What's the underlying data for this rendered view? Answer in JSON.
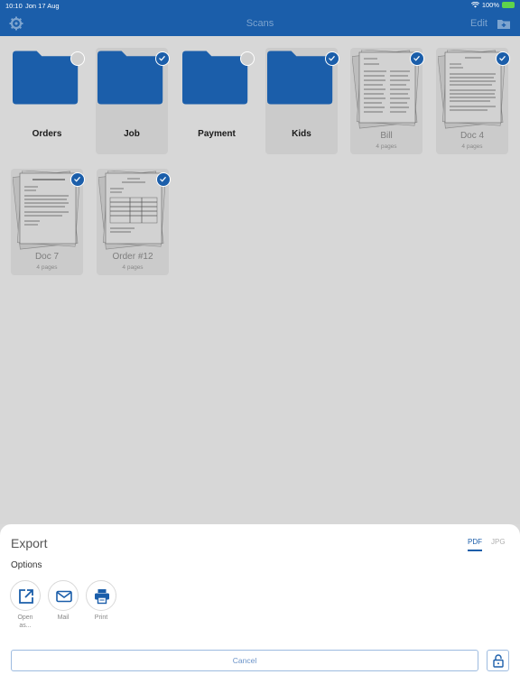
{
  "status_bar": {
    "time": "10:10",
    "date": "Jon 17 Aug",
    "battery": "100%"
  },
  "nav": {
    "title": "Scans",
    "edit_label": "Edit"
  },
  "items": [
    {
      "label": "Orders",
      "type": "folder",
      "checked": false
    },
    {
      "label": "Job",
      "type": "folder",
      "checked": true
    },
    {
      "label": "Payment",
      "type": "folder",
      "checked": false
    },
    {
      "label": "Kids",
      "type": "folder",
      "checked": true
    },
    {
      "label": "Bill",
      "type": "doc",
      "pages": "4 pages",
      "checked": true
    },
    {
      "label": "Doc 4",
      "type": "doc",
      "pages": "4 pages",
      "checked": true
    },
    {
      "label": "Doc 7",
      "type": "doc",
      "pages": "4 pages",
      "checked": true
    },
    {
      "label": "Order #12",
      "type": "doc",
      "pages": "4 pages",
      "checked": true
    }
  ],
  "export": {
    "title": "Export",
    "format_pdf": "PDF",
    "format_jpg": "JPG",
    "options_label": "Options",
    "actions": [
      {
        "label": "Open as..."
      },
      {
        "label": "Mail"
      },
      {
        "label": "Print"
      }
    ],
    "cancel_label": "Cancel"
  },
  "colors": {
    "accent": "#1b5eaa",
    "folder": "#1b5eaa"
  }
}
